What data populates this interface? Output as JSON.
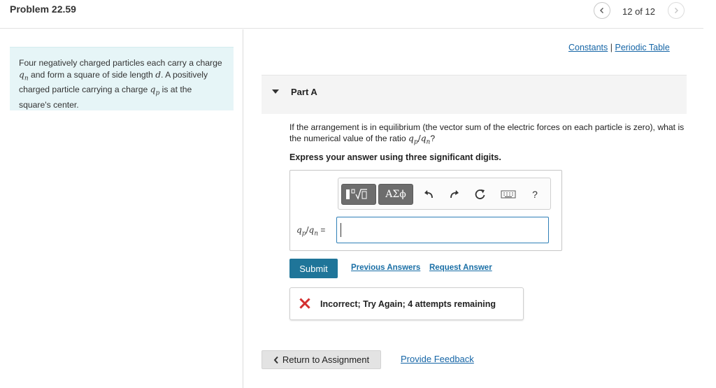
{
  "header": {
    "problem_title": "Problem 22.59",
    "page_count": "12 of 12"
  },
  "description": {
    "text1": "Four negatively charged particles each carry a charge ",
    "qn_var": "q",
    "qn_sub": "n",
    "text2": " and form a square of side length ",
    "d_var": "d",
    "text3": ". A positively charged particle carrying a charge ",
    "qp_var": "q",
    "qp_sub": "p",
    "text4": " is at the square's center."
  },
  "links": {
    "constants": "Constants",
    "separator": " | ",
    "periodic_table": "Periodic Table"
  },
  "part": {
    "label": "Part A"
  },
  "question": {
    "line1": "If the arrangement is in equilibrium (the vector sum of the electric forces on each particle is zero), what is the numerical value of the ratio ",
    "ratio_q1": "q",
    "ratio_sub1": "p",
    "ratio_slash": "/",
    "ratio_q2": "q",
    "ratio_sub2": "n",
    "end": "?",
    "instruction": "Express your answer using three significant digits."
  },
  "toolbar": {
    "greek_label": "ΑΣϕ",
    "help_label": "?"
  },
  "answer": {
    "label_q1": "q",
    "label_sub1": "p",
    "label_slash": "/",
    "label_q2": "q",
    "label_sub2": "n",
    "label_eq": " =",
    "value": ""
  },
  "actions": {
    "submit": "Submit",
    "previous_answers": "Previous Answers",
    "request_answer": "Request Answer"
  },
  "feedback": {
    "message": "Incorrect; Try Again; 4 attempts remaining",
    "status_color": "#d32f2f"
  },
  "footer": {
    "return_label": "Return to Assignment",
    "provide_feedback": "Provide Feedback"
  },
  "colors": {
    "accent": "#1f7599",
    "link": "#1565a6",
    "description_bg": "#e6f5f7"
  }
}
